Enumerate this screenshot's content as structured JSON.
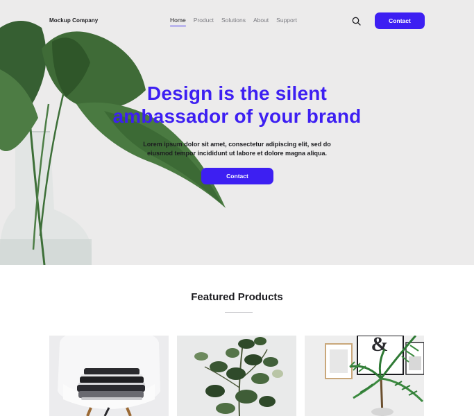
{
  "nav": {
    "brand": "Mockup Company",
    "items": [
      {
        "label": "Home",
        "active": true
      },
      {
        "label": "Product",
        "active": false
      },
      {
        "label": "Solutions",
        "active": false
      },
      {
        "label": "About",
        "active": false
      },
      {
        "label": "Support",
        "active": false
      }
    ],
    "search_icon": "search-icon",
    "contact_label": "Contact"
  },
  "hero": {
    "headline_line1": "Design is the silent",
    "headline_line2": "ambassador of your brand",
    "subtext": "Lorem ipsum dolor sit amet, consectetur adipiscing elit, sed do eiusmod tempor incididunt ut labore et dolore magna aliqua.",
    "cta_label": "Contact"
  },
  "featured": {
    "title": "Featured Products"
  },
  "colors": {
    "accent": "#3d1ff2",
    "hero_bg": "#ecebeb",
    "text": "#1b1b1f",
    "muted": "#7a7a80"
  }
}
